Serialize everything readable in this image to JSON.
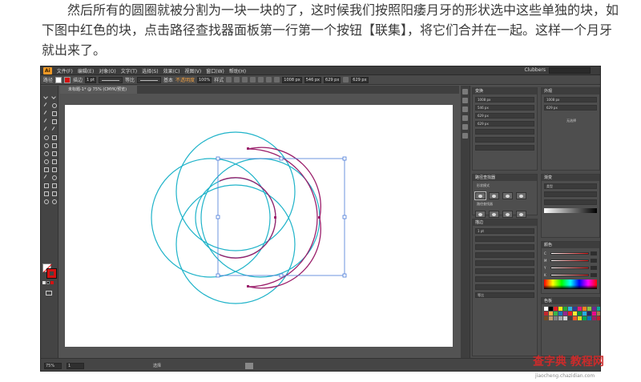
{
  "tutorial": {
    "paragraph": "然后所有的圆圈就被分割为一块一块的了，这时候我们按照阳痿月牙的形状选中这些单独的块，如下图中红色的块，点击路径查找器面板第一行第一个按钮【联集】，将它们合并在一起。这样一个月牙就出来了。"
  },
  "app": {
    "logo": "Ai",
    "menus": [
      "文件(F)",
      "编辑(E)",
      "对象(O)",
      "文字(T)",
      "选择(S)",
      "效果(C)",
      "视图(V)",
      "窗口(W)",
      "帮助(H)"
    ],
    "workspace": "Clubbers"
  },
  "control_bar": {
    "path_label": "路径",
    "stroke_label": "描边",
    "stroke_value": "1 pt",
    "stroke_profile": "等比",
    "basic_label": "基本",
    "opacity_label": "不透明度",
    "opacity_value": "100%",
    "style_label": "样式",
    "x_value": "1008 px",
    "y_value": "546 px",
    "w_value": "629 px",
    "h_value": "629 px"
  },
  "document": {
    "tab_title": "未标题-1* @ 75% (CMYK/预览)"
  },
  "status_bar": {
    "zoom": "75%",
    "page": "1",
    "tool_name": "选择"
  },
  "panels": {
    "transform_title": "变换",
    "align_title": "对齐",
    "pathfinder_title": "路径查找器",
    "pathfinder_shape_modes": "形状模式",
    "pathfinder_pathfinders": "路径查找器",
    "pathfinder_expand": "扩展",
    "stroke_title": "描边",
    "stroke_weight_label": "粗细",
    "gradient_title": "渐变",
    "gradient_type": "类型",
    "color_title": "颜色",
    "swatches_title": "色板",
    "no_selection": "无选择",
    "appearance_title": "外观"
  },
  "colors": {
    "cyan_stroke": "#1fb3c9",
    "magenta_stroke": "#9b1f6b",
    "selection_blue": "#4a7bd8",
    "fill_red": "#d41111"
  },
  "watermark": {
    "brand": "查字典 教程网",
    "url": "jiaocheng.chazidian.com"
  }
}
